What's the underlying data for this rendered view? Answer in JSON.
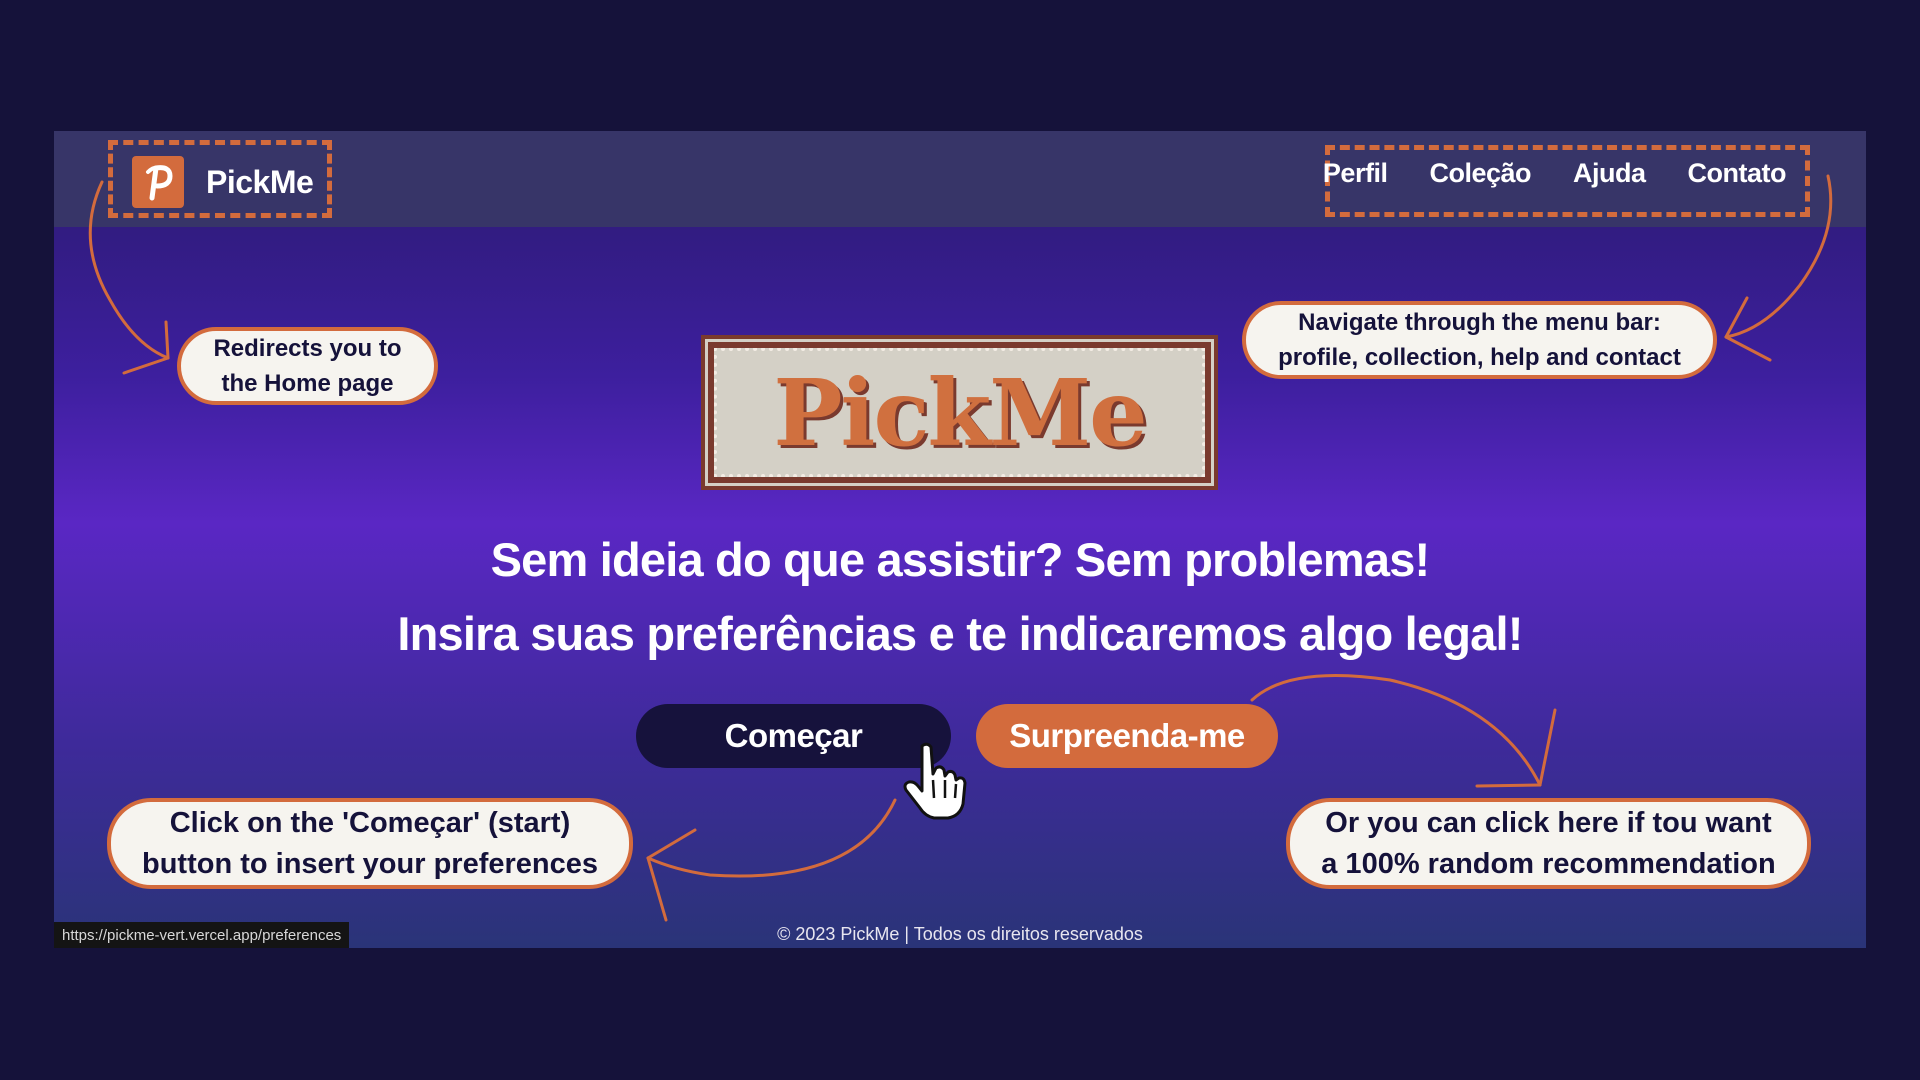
{
  "brand": {
    "name": "PickMe",
    "logo_letter": "P"
  },
  "nav": {
    "items": [
      {
        "label": "Perfil"
      },
      {
        "label": "Coleção"
      },
      {
        "label": "Ajuda"
      },
      {
        "label": "Contato"
      }
    ]
  },
  "hero": {
    "marquee_text": "PickMe",
    "line1": "Sem ideia do que assistir? Sem problemas!",
    "line2": "Insira suas preferências e te indicaremos algo legal!"
  },
  "buttons": {
    "start": "Começar",
    "surprise": "Surpreenda-me"
  },
  "footer": {
    "text": "© 2023 PickMe | Todos os direitos reservados"
  },
  "status_bar": {
    "url": "https://pickme-vert.vercel.app/preferences"
  },
  "annotations": {
    "home": {
      "line1": "Redirects you to",
      "line2": "the Home page"
    },
    "menu": {
      "line1": "Navigate through the menu bar:",
      "line2": "profile, collection, help and contact"
    },
    "start": {
      "line1": "Click on the 'Começar' (start)",
      "line2": "button to insert your preferences"
    },
    "random": {
      "line1": "Or you can click here if tou want",
      "line2": "a 100% random recommendation"
    }
  },
  "colors": {
    "accent": "#d36b3d",
    "page_background": "#15123a",
    "navbar": "#373568",
    "dark_button": "#16123c"
  }
}
